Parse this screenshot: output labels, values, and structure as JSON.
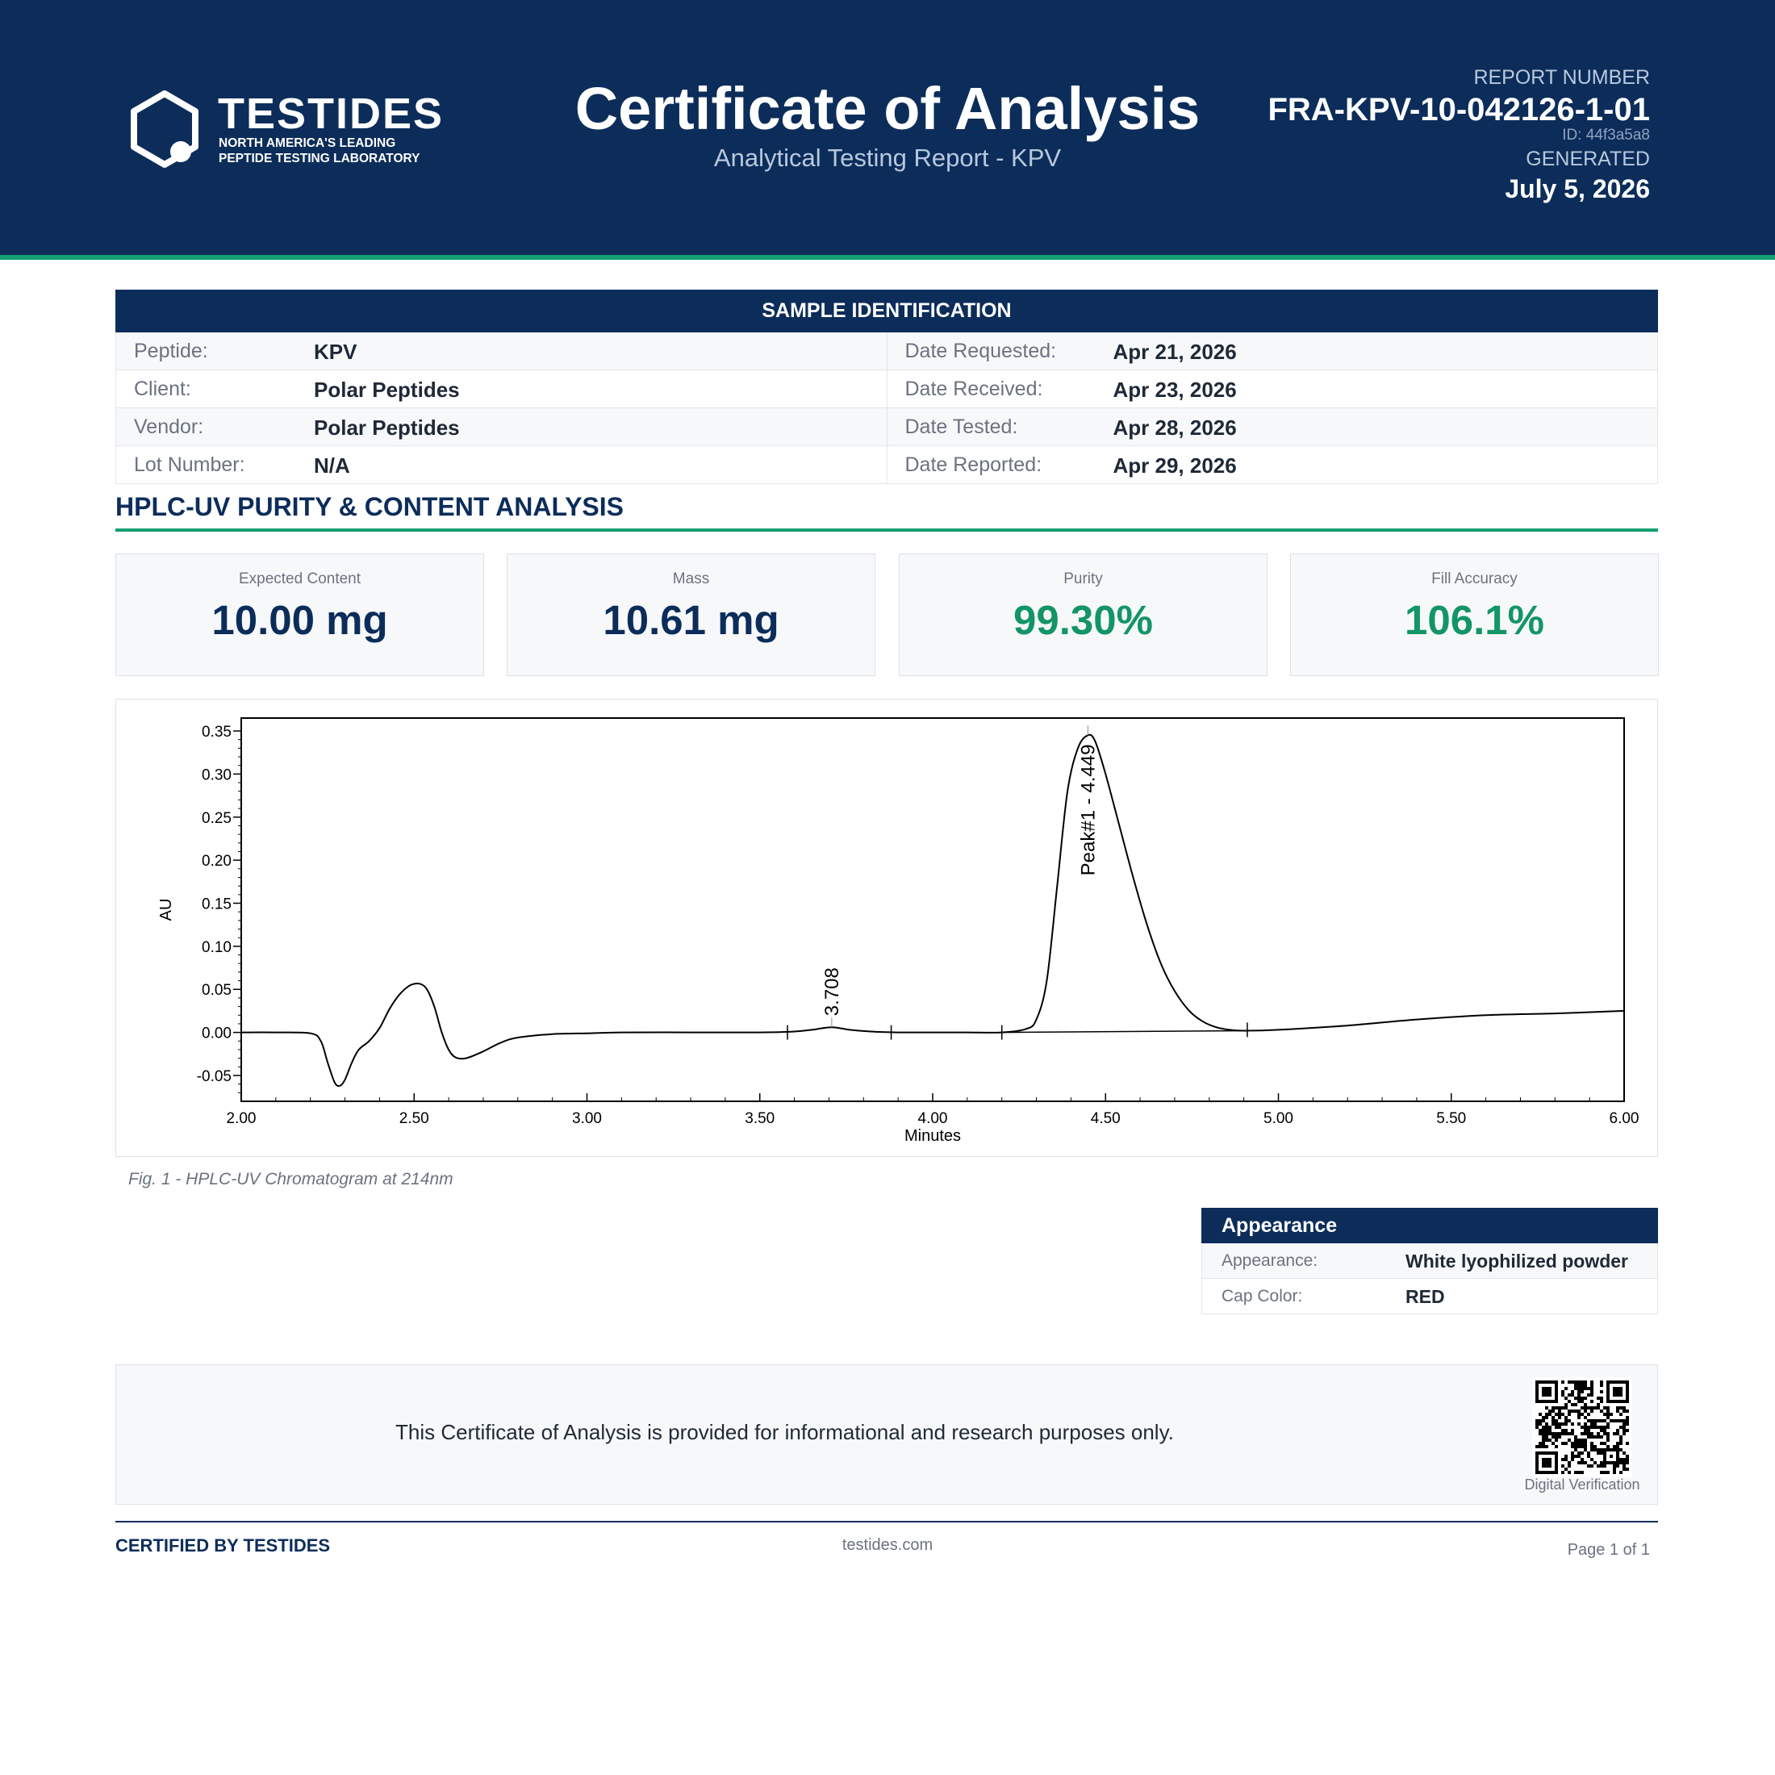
{
  "header": {
    "brand_name": "TESTIDES",
    "brand_tagline_1": "NORTH AMERICA'S LEADING",
    "brand_tagline_2": "PEPTIDE TESTING LABORATORY",
    "title": "Certificate of Analysis",
    "subtitle": "Analytical Testing Report  -  KPV",
    "report_number_label": "REPORT NUMBER",
    "report_number": "FRA-KPV-10-042126-1-01",
    "report_id": "ID: 44f3a5a8",
    "generated_label": "GENERATED",
    "generated_date": "July 5, 2026"
  },
  "colors": {
    "navy": "#0c2d5a",
    "accent_green": "#13a06f",
    "value_green": "#139566"
  },
  "sample_identification": {
    "heading": "SAMPLE IDENTIFICATION",
    "rows": [
      {
        "left_label": "Peptide:",
        "left_value": "KPV",
        "right_label": "Date Requested:",
        "right_value": "Apr 21, 2026"
      },
      {
        "left_label": "Client:",
        "left_value": "Polar Peptides",
        "right_label": "Date Received:",
        "right_value": "Apr 23, 2026"
      },
      {
        "left_label": "Vendor:",
        "left_value": "Polar Peptides",
        "right_label": "Date Tested:",
        "right_value": "Apr 28, 2026"
      },
      {
        "left_label": "Lot Number:",
        "left_value": "N/A",
        "right_label": "Date Reported:",
        "right_value": "Apr 29, 2026"
      }
    ]
  },
  "analysis": {
    "section_title": "HPLC-UV PURITY & CONTENT ANALYSIS",
    "metrics": [
      {
        "label": "Expected Content",
        "value": "10.00 mg"
      },
      {
        "label": "Mass",
        "value": "10.61 mg"
      },
      {
        "label": "Purity",
        "value": "99.30%"
      },
      {
        "label": "Fill Accuracy",
        "value": "106.1%"
      }
    ],
    "figure_caption": "Fig. 1  -  HPLC-UV Chromatogram at 214nm"
  },
  "chart_data": {
    "type": "line",
    "xlabel": "Minutes",
    "ylabel": "AU",
    "xlim": [
      2.0,
      6.0
    ],
    "ylim": [
      -0.08,
      0.365
    ],
    "x_ticks": [
      2.0,
      2.5,
      3.0,
      3.5,
      4.0,
      4.5,
      5.0,
      5.5,
      6.0
    ],
    "x_tick_labels": [
      "2.00",
      "2.50",
      "3.00",
      "3.50",
      "4.00",
      "4.50",
      "5.00",
      "5.50",
      "6.00"
    ],
    "y_ticks": [
      -0.05,
      0.0,
      0.05,
      0.1,
      0.15,
      0.2,
      0.25,
      0.3,
      0.35
    ],
    "y_tick_labels": [
      "-0.05",
      "0.00",
      "0.05",
      "0.10",
      "0.15",
      "0.20",
      "0.25",
      "0.30",
      "0.35"
    ],
    "grid": false,
    "series": [
      {
        "x": [
          2.0,
          2.1,
          2.2,
          2.23,
          2.25,
          2.27,
          2.285,
          2.3,
          2.32,
          2.34,
          2.37,
          2.4,
          2.43,
          2.46,
          2.49,
          2.52,
          2.54,
          2.56,
          2.58,
          2.6,
          2.62,
          2.65,
          2.7,
          2.75,
          2.8,
          2.9,
          3.0,
          3.1,
          3.3,
          3.5,
          3.6,
          3.65,
          3.708,
          3.76,
          3.82,
          3.9,
          4.0,
          4.1,
          4.2,
          4.27,
          4.3,
          4.33,
          4.36,
          4.39,
          4.42,
          4.449,
          4.47,
          4.5,
          4.54,
          4.58,
          4.62,
          4.66,
          4.7,
          4.74,
          4.78,
          4.82,
          4.86,
          4.9,
          5.0,
          5.2,
          5.4,
          5.6,
          5.8,
          6.0
        ],
        "y": [
          0.0,
          0.0,
          -0.001,
          -0.01,
          -0.035,
          -0.058,
          -0.062,
          -0.055,
          -0.035,
          -0.02,
          -0.01,
          0.005,
          0.028,
          0.045,
          0.055,
          0.056,
          0.048,
          0.028,
          0.0,
          -0.02,
          -0.029,
          -0.03,
          -0.022,
          -0.012,
          -0.006,
          -0.002,
          -0.001,
          0.0,
          0.0,
          0.0,
          0.001,
          0.003,
          0.006,
          0.003,
          0.001,
          0.0,
          0.0,
          0.0,
          0.0,
          0.004,
          0.015,
          0.06,
          0.17,
          0.28,
          0.33,
          0.345,
          0.338,
          0.3,
          0.24,
          0.18,
          0.125,
          0.08,
          0.048,
          0.026,
          0.013,
          0.006,
          0.003,
          0.002,
          0.003,
          0.008,
          0.015,
          0.02,
          0.022,
          0.025
        ]
      }
    ],
    "peak_labels": [
      {
        "x": 3.708,
        "y": 0.006,
        "text": "3.708"
      },
      {
        "x": 4.449,
        "y": 0.345,
        "text": "Peak#1 - 4.449"
      }
    ],
    "integration_marks_x": [
      3.58,
      3.88,
      4.2,
      4.91
    ]
  },
  "appearance": {
    "heading": "Appearance",
    "rows": [
      {
        "label": "Appearance:",
        "value": "White lyophilized powder"
      },
      {
        "label": "Cap Color:",
        "value": "RED"
      }
    ]
  },
  "disclaimer": {
    "text": "This Certificate of Analysis is provided for informational and research purposes only.",
    "qr_label": "Digital Verification",
    "qr_icon": "qr-code-icon"
  },
  "footer": {
    "certified": "CERTIFIED BY TESTIDES",
    "website": "testides.com",
    "page": "Page 1 of 1"
  }
}
